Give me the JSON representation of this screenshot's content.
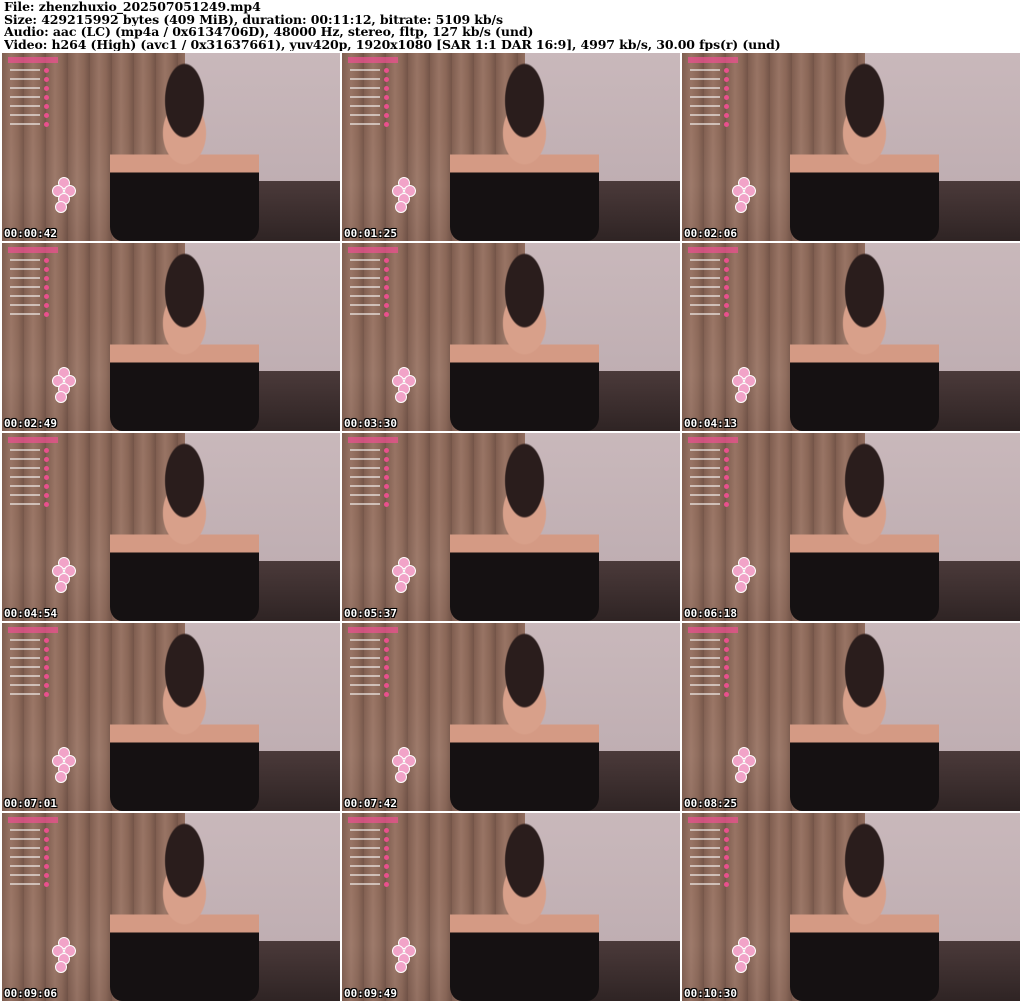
{
  "header": {
    "file": "File: zhenzhuxio_202507051249.mp4",
    "size": "Size: 429215992 bytes (409 MiB), duration: 00:11:12, bitrate: 5109 kb/s",
    "audio": "Audio: aac (LC) (mp4a / 0x6134706D), 48000 Hz, stereo, fltp, 127 kb/s (und)",
    "video": "Video: h264 (High) (avc1 / 0x31637661), yuv420p, 1920x1080 [SAR 1:1 DAR 16:9], 4997 kb/s, 30.00 fps(r) (und)"
  },
  "thumbnails": [
    {
      "timestamp": "00:00:42"
    },
    {
      "timestamp": "00:01:25"
    },
    {
      "timestamp": "00:02:06"
    },
    {
      "timestamp": "00:02:49"
    },
    {
      "timestamp": "00:03:30"
    },
    {
      "timestamp": "00:04:13"
    },
    {
      "timestamp": "00:04:54"
    },
    {
      "timestamp": "00:05:37"
    },
    {
      "timestamp": "00:06:18"
    },
    {
      "timestamp": "00:07:01"
    },
    {
      "timestamp": "00:07:42"
    },
    {
      "timestamp": "00:08:25"
    },
    {
      "timestamp": "00:09:06"
    },
    {
      "timestamp": "00:09:49"
    },
    {
      "timestamp": "00:10:30"
    }
  ],
  "colors": {
    "accent": "#e9508d",
    "timestamp_text": "#ffffff"
  }
}
